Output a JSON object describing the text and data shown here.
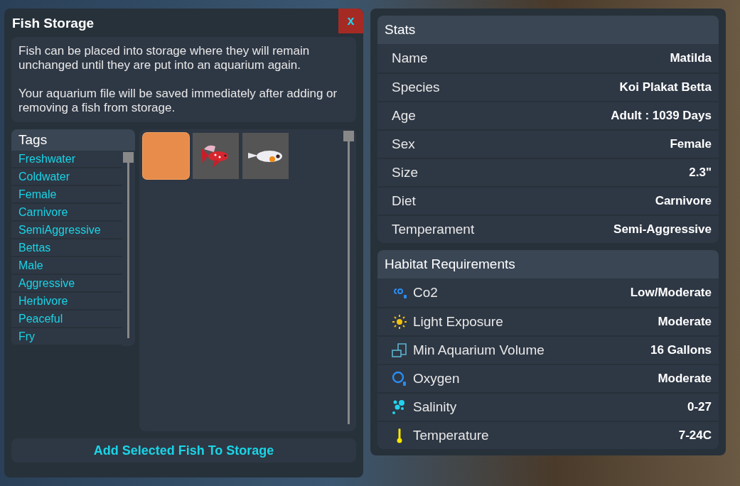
{
  "storage_window": {
    "title": "Fish Storage",
    "close_label": "x",
    "description": [
      "Fish can be placed into storage where they will remain unchanged until they are put into an aquarium again.",
      "Your aquarium file will be saved immediately after adding or removing a fish from storage."
    ],
    "tags": {
      "title": "Tags",
      "items": [
        "Freshwater",
        "Coldwater",
        "Female",
        "Carnivore",
        "SemiAggressive",
        "Bettas",
        "Male",
        "Aggressive",
        "Herbivore",
        "Peaceful",
        "Fry"
      ]
    },
    "fish_slots": [
      {
        "kind": "empty",
        "selected": true
      },
      {
        "kind": "betta",
        "selected": false
      },
      {
        "kind": "fry",
        "selected": false
      }
    ],
    "add_button": "Add Selected Fish To Storage"
  },
  "stats": {
    "title": "Stats",
    "rows": [
      {
        "label": "Name",
        "value": "Matilda"
      },
      {
        "label": "Species",
        "value": "Koi Plakat Betta"
      },
      {
        "label": "Age",
        "value": "Adult : 1039 Days"
      },
      {
        "label": "Sex",
        "value": "Female"
      },
      {
        "label": "Size",
        "value": "2.3\""
      },
      {
        "label": "Diet",
        "value": "Carnivore"
      },
      {
        "label": "Temperament",
        "value": "Semi-Aggressive"
      }
    ]
  },
  "habitat": {
    "title": "Habitat Requirements",
    "rows": [
      {
        "kind": "co2",
        "label": "Co2",
        "value": "Low/Moderate"
      },
      {
        "kind": "light",
        "label": "Light Exposure",
        "value": "Moderate"
      },
      {
        "kind": "volume",
        "label": "Min Aquarium Volume",
        "value": "16 Gallons"
      },
      {
        "kind": "oxygen",
        "label": "Oxygen",
        "value": "Moderate"
      },
      {
        "kind": "salinity",
        "label": "Salinity",
        "value": "0-27"
      },
      {
        "kind": "temperature",
        "label": "Temperature",
        "value": "7-24C"
      }
    ]
  }
}
